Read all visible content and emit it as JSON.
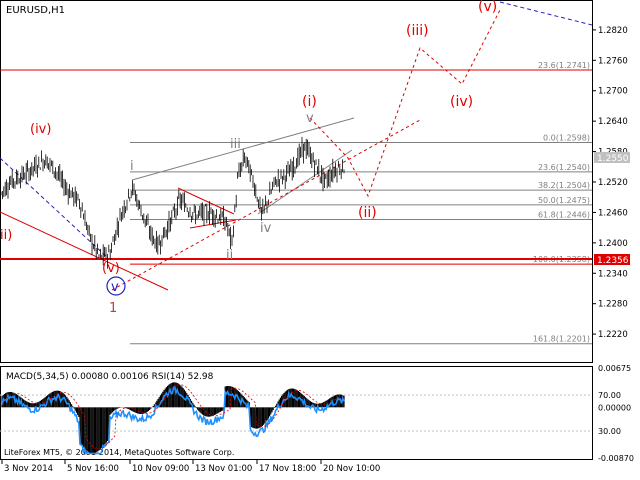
{
  "chart_data": {
    "type": "candlestick",
    "symbol_label": "EURUSD,H1",
    "footer_label": "LiteForex MT5, © 2001-2014, MetaQuotes Software Corp.",
    "price_axis": {
      "ylim": [
        1.2165,
        1.2875
      ],
      "ticks": [
        "1.2820",
        "1.2760",
        "1.2700",
        "1.2640",
        "1.2580",
        "1.2520",
        "1.2460",
        "1.2400",
        "1.2340",
        "1.2280",
        "1.2220"
      ],
      "current_price_label": "1.2550",
      "current_price": 1.255,
      "support_label": "1.2356",
      "support_price": 1.2356
    },
    "time_axis": {
      "ticks": [
        "3 Nov 2014",
        "5 Nov 16:00",
        "10 Nov 09:00",
        "13 Nov 01:00",
        "17 Nov 18:00",
        "20 Nov 10:00"
      ]
    },
    "fibonacci_levels": [
      {
        "label": "0.0(1.2598)",
        "value": 1.2598
      },
      {
        "label": "23.6(1.2540)",
        "value": 1.254
      },
      {
        "label": "38.2(1.2504)",
        "value": 1.2504
      },
      {
        "label": "50.0(1.2475)",
        "value": 1.2475
      },
      {
        "label": "61.8(1.2446)",
        "value": 1.2446
      },
      {
        "label": "100.0(1.2358)",
        "value": 1.2358
      },
      {
        "label": "161.8(1.2201)",
        "value": 1.2201
      },
      {
        "label": "23.6(1.2741)",
        "value": 1.2741
      }
    ],
    "wave_labels": {
      "red_i": "(i)",
      "red_ii": "(ii)",
      "red_iii": "(iii)",
      "red_iv": "(iv)",
      "red_v": "(v)",
      "left_iv": "(iv)",
      "left_v": "(v)",
      "left_ii": "ii)",
      "blue_v": "v",
      "num_1": "1",
      "grey_i": "i",
      "grey_ii": "ii",
      "grey_iii": "iii",
      "grey_iv": "iv",
      "grey_v": "v"
    },
    "indicator": {
      "label": "MACD(5,34,5) 0.00080 0.00106 RSI(14) 52.98",
      "left_ticks": [
        "0.00675",
        "0.00000",
        "-0.00870"
      ],
      "right_ticks": [
        "70.00",
        "30.00"
      ],
      "ylim": [
        -0.0087,
        0.00675
      ],
      "rsi_ylim": [
        0,
        100
      ]
    },
    "colors": {
      "red": "#e00000",
      "grey_wave": "#808080",
      "blue": "#2020c0",
      "rsi": "#1e90ff"
    }
  }
}
